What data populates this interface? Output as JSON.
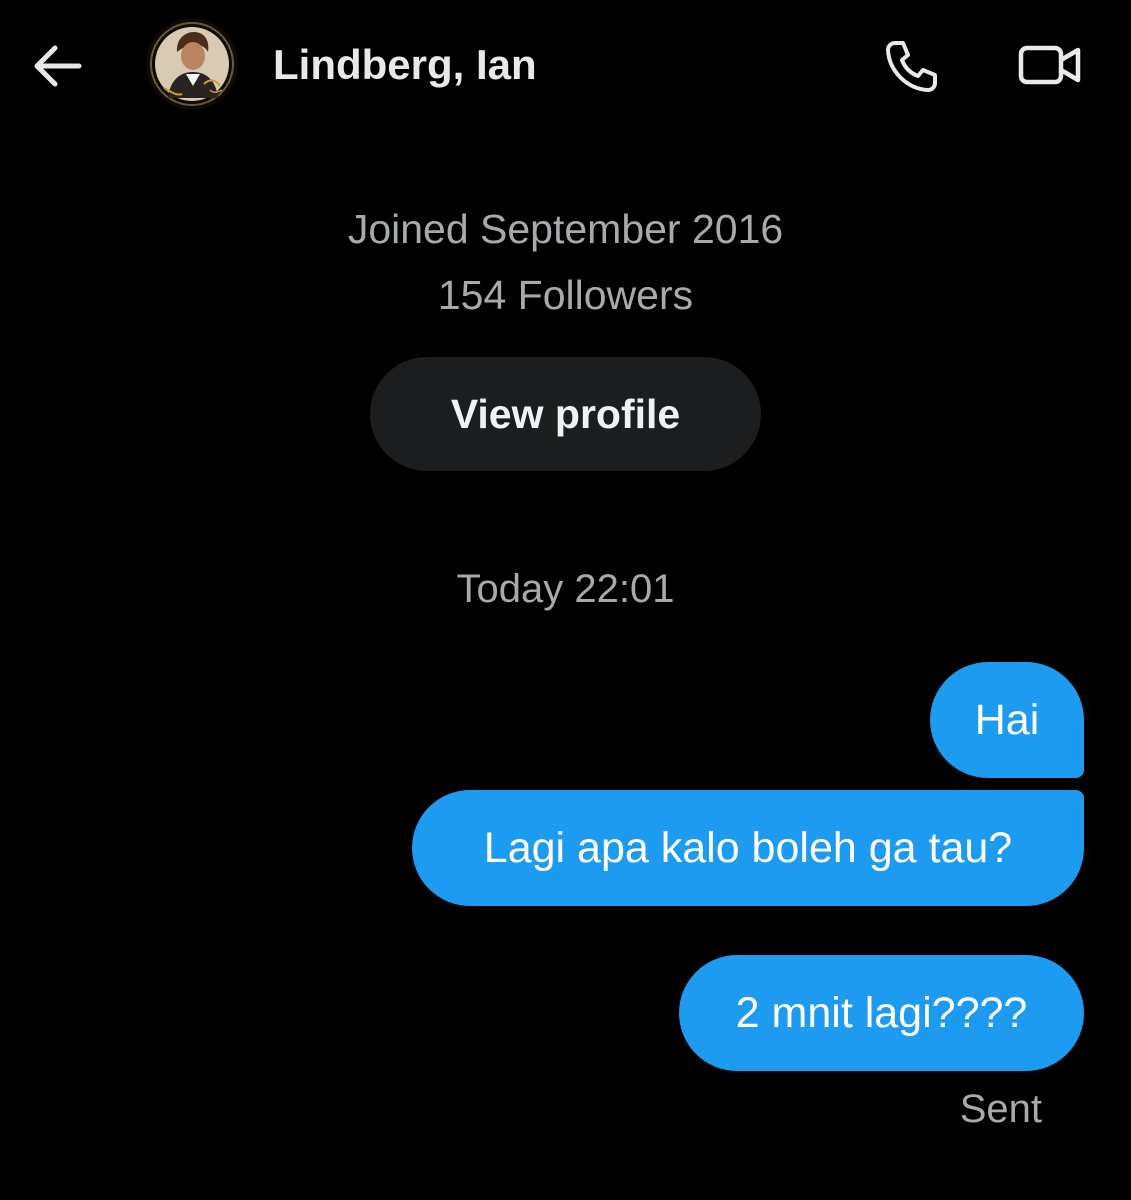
{
  "header": {
    "back_icon": "arrow-left-icon",
    "avatar_icon": "profile-photo",
    "title": "Lindberg, Ian",
    "call_icon": "phone-icon",
    "video_icon": "video-camera-icon"
  },
  "profile": {
    "joined": "Joined September 2016",
    "followers": "154 Followers",
    "view_profile_label": "View profile"
  },
  "conversation": {
    "timestamp": "Today 22:01",
    "messages": [
      {
        "text": "Hai",
        "direction": "outgoing"
      },
      {
        "text": "Lagi apa kalo boleh ga tau?",
        "direction": "outgoing"
      },
      {
        "text": "2 mnit lagi????",
        "direction": "outgoing"
      }
    ],
    "status": "Sent"
  },
  "colors": {
    "background": "#000000",
    "bubble": "#1d9bf0",
    "muted_text": "#a7aaad",
    "button_bg": "#1c1d1f"
  }
}
